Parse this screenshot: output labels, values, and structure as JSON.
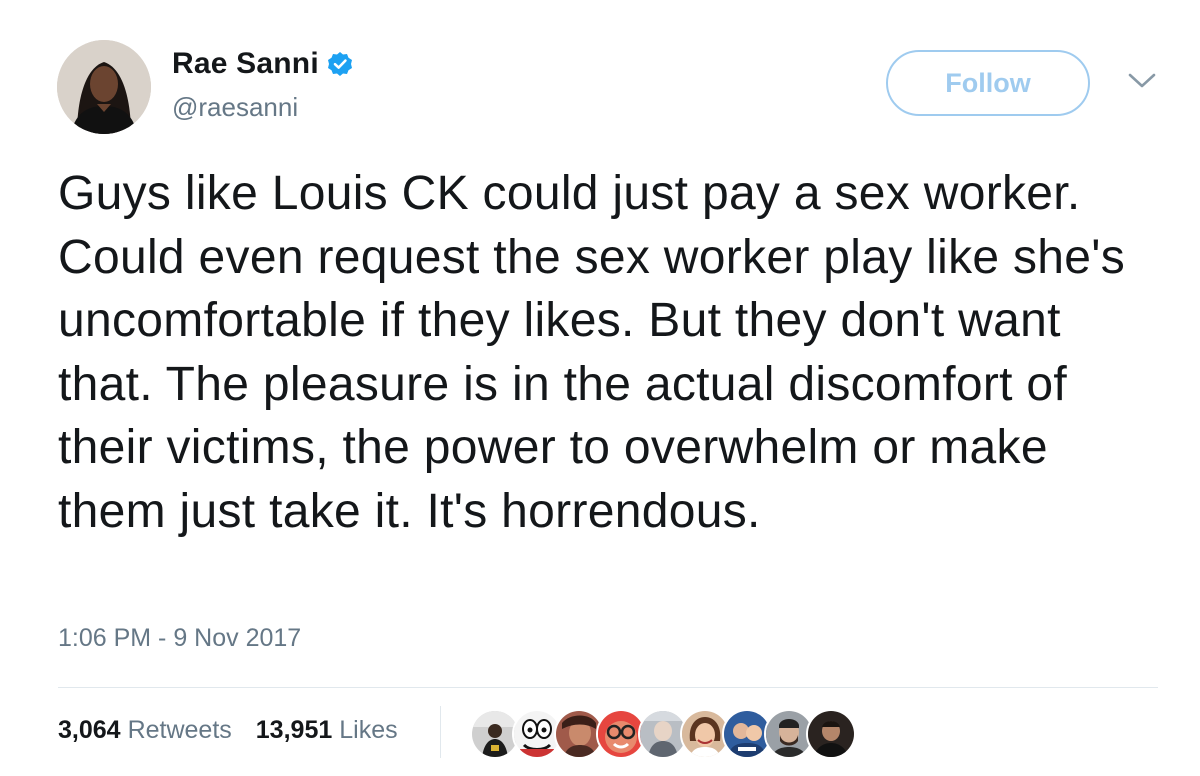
{
  "user": {
    "display_name": "Rae Sanni",
    "handle": "@raesanni",
    "verified": true
  },
  "actions": {
    "follow_label": "Follow"
  },
  "tweet": {
    "text": "Guys like Louis CK could just pay a sex worker. Could even request the sex worker play like she's uncomfortable if they likes. But they don't want that. The pleasure is in the actual discomfort of their victims, the power to overwhelm or make them just take it. It's horrendous.",
    "timestamp": "1:06 PM - 9 Nov 2017"
  },
  "stats": {
    "retweets_count": "3,064",
    "retweets_label": "Retweets",
    "likes_count": "13,951",
    "likes_label": "Likes"
  },
  "likers": [
    {
      "icon": "avatar-person-dark"
    },
    {
      "icon": "avatar-cartoon"
    },
    {
      "icon": "avatar-person-red"
    },
    {
      "icon": "avatar-person-glasses"
    },
    {
      "icon": "avatar-person-gray"
    },
    {
      "icon": "avatar-person-smile"
    },
    {
      "icon": "avatar-person-blue"
    },
    {
      "icon": "avatar-person-beard"
    },
    {
      "icon": "avatar-person-dim"
    }
  ],
  "colors": {
    "brand_blue": "#1da1f2",
    "follow_border": "#9fcbef",
    "muted_text": "#657786",
    "text": "#14171a"
  }
}
